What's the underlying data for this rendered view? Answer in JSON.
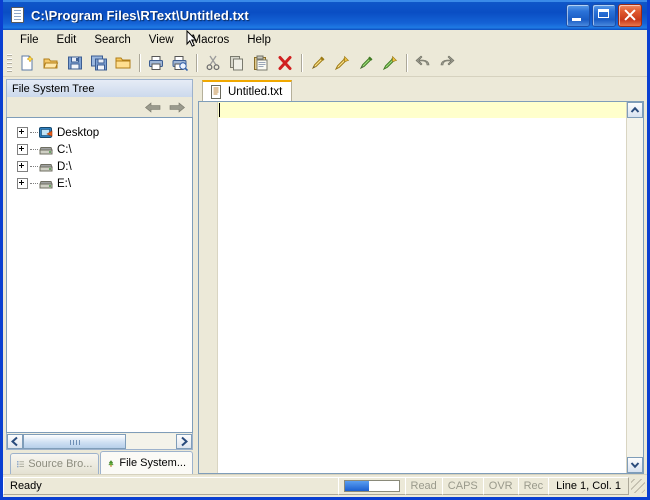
{
  "window": {
    "title": "C:\\Program Files\\RText\\Untitled.txt",
    "title_icon": "document-icon",
    "minimize_label": "Minimize",
    "maximize_label": "Maximize",
    "close_label": "Close",
    "accent_color": "#0a4ec4",
    "face_color": "#ece9d8"
  },
  "menu": {
    "items": [
      {
        "label": "File"
      },
      {
        "label": "Edit"
      },
      {
        "label": "Search"
      },
      {
        "label": "View"
      },
      {
        "label": "Macros"
      },
      {
        "label": "Help"
      }
    ]
  },
  "toolbar": {
    "buttons": [
      {
        "name": "new-file-icon",
        "tooltip": "New"
      },
      {
        "name": "open-file-icon",
        "tooltip": "Open"
      },
      {
        "name": "save-icon",
        "tooltip": "Save"
      },
      {
        "name": "save-all-icon",
        "tooltip": "Save All"
      },
      {
        "name": "open-folder-icon",
        "tooltip": "Open Folder"
      },
      {
        "name": "separator",
        "tooltip": ""
      },
      {
        "name": "print-icon",
        "tooltip": "Print"
      },
      {
        "name": "print-preview-icon",
        "tooltip": "Print Preview"
      },
      {
        "name": "separator",
        "tooltip": ""
      },
      {
        "name": "cut-icon",
        "tooltip": "Cut"
      },
      {
        "name": "copy-icon",
        "tooltip": "Copy"
      },
      {
        "name": "paste-icon",
        "tooltip": "Paste"
      },
      {
        "name": "delete-icon",
        "tooltip": "Delete"
      },
      {
        "name": "separator",
        "tooltip": ""
      },
      {
        "name": "find-icon",
        "tooltip": "Find"
      },
      {
        "name": "find-next-icon",
        "tooltip": "Find Next"
      },
      {
        "name": "replace-icon",
        "tooltip": "Replace"
      },
      {
        "name": "replace-next-icon",
        "tooltip": "Replace Next"
      },
      {
        "name": "separator",
        "tooltip": ""
      },
      {
        "name": "undo-icon",
        "tooltip": "Undo"
      },
      {
        "name": "redo-icon",
        "tooltip": "Redo"
      }
    ]
  },
  "left_panel": {
    "title": "File System Tree",
    "back_label": "Back",
    "forward_label": "Forward",
    "tree": [
      {
        "label": "Desktop",
        "icon": "desktop-icon",
        "expanded": false
      },
      {
        "label": "C:\\",
        "icon": "drive-icon",
        "expanded": false
      },
      {
        "label": "D:\\",
        "icon": "drive-icon",
        "expanded": false
      },
      {
        "label": "E:\\",
        "icon": "drive-icon",
        "expanded": false
      }
    ],
    "tabs": [
      {
        "label": "Source Bro...",
        "icon": "list-icon",
        "active": false
      },
      {
        "label": "File System...",
        "icon": "tree-icon",
        "active": true
      }
    ]
  },
  "editor": {
    "tabs": [
      {
        "label": "Untitled.txt",
        "icon": "document-icon",
        "active": true
      }
    ],
    "content": "",
    "current_line_color": "#ffffcc",
    "scroll_up_label": "Scroll Up",
    "scroll_down_label": "Scroll Down"
  },
  "statusbar": {
    "message": "Ready",
    "progress_percent": 45,
    "cells": [
      {
        "label": "Read",
        "enabled": false
      },
      {
        "label": "CAPS",
        "enabled": false
      },
      {
        "label": "OVR",
        "enabled": false
      },
      {
        "label": "Rec",
        "enabled": false
      }
    ],
    "caret_position": "Line 1, Col. 1"
  }
}
